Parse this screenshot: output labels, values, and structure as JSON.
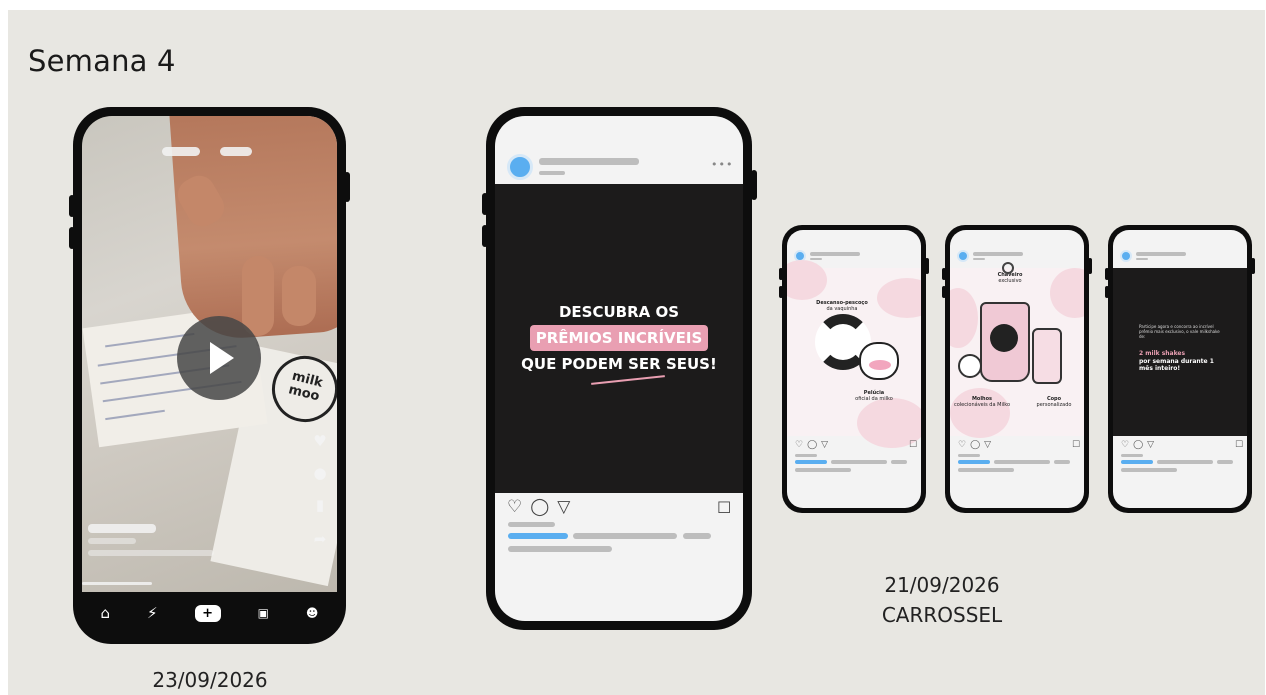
{
  "page": {
    "title": "Semana 4"
  },
  "reel": {
    "date": "23/09/2026",
    "stamp_text": "milk moo",
    "nav_icons": [
      "home-icon",
      "bolt-icon",
      "plus-icon",
      "inbox-icon",
      "profile-icon"
    ],
    "side_icons": [
      "heart-icon",
      "comment-icon",
      "bookmark-icon",
      "share-icon"
    ]
  },
  "post": {
    "line1": "DESCUBRA OS",
    "line2": "PRÊMIOS INCRÍVEIS",
    "line3": "QUE PODEM SER SEUS!",
    "accent_pink": "#e99fb2",
    "accent_blue": "#5aaef0"
  },
  "carousel": {
    "date": "21/09/2026",
    "label": "CARROSSEL",
    "slide1": {
      "top_label": "Descanso-pescoço",
      "top_sub": "da vaquinha",
      "bottom_label": "Pelúcia",
      "bottom_sub": "oficial da milko"
    },
    "slide2": {
      "top_label": "Chaveiro",
      "top_sub": "exclusivo",
      "left_label": "Molhos",
      "left_sub": "colecionáveis da Milko",
      "right_label": "Copo",
      "right_sub": "personalizado"
    },
    "slide3": {
      "intro": "Participe agora e concorra ao incrível prêmio mais exclusivo, o vale milkshake de:",
      "highlight": "2 milk shakes",
      "rest": "por semana durante 1 mês inteiro!"
    }
  }
}
